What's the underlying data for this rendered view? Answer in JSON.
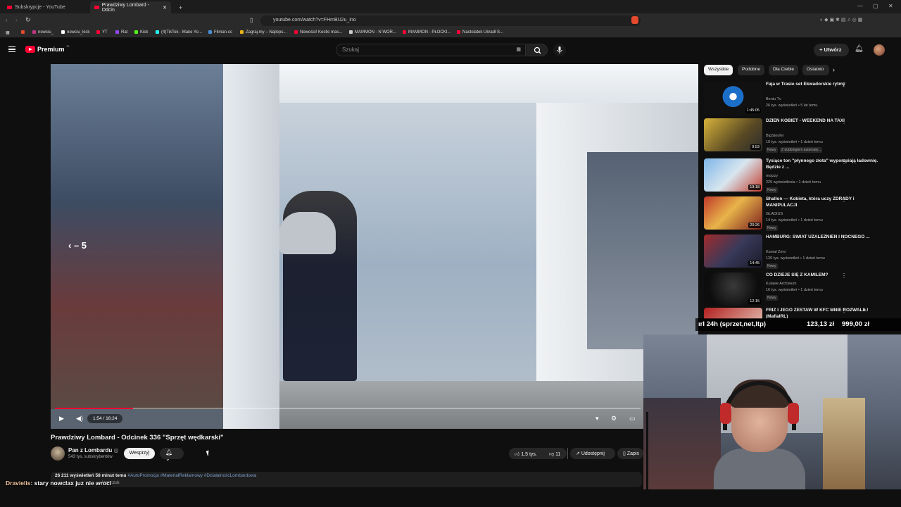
{
  "browser": {
    "tabs": [
      {
        "label": "Subskrypcje - YouTube"
      },
      {
        "label": "Prawdziwy Lombard - Odcin"
      }
    ],
    "url": "youtube.com/watch?v=FHmBU2u_ino",
    "bookmarks": [
      "nowciu_",
      "nowciu_kick",
      "YT",
      "Rat",
      "Kick",
      "(4)TikTok - Make Yo...",
      "Filman.cc",
      "Zagraj.my – Najleps...",
      "Nowości! Kostki mas...",
      "MAMMON - N WOR...",
      "MAMMON - PŁOCKI...",
      "Nastolatek Ukradł S..."
    ]
  },
  "header": {
    "logo_text": "Premium",
    "logo_sup": "PL",
    "search_placeholder": "Szukaj",
    "create_label": "+ Utwórz"
  },
  "player": {
    "seek_indicator": "‹ – 5",
    "time": "1:54 / 16:24",
    "progress": 0.133
  },
  "video": {
    "title": "Prawdziwy Lombard - Odcinek 336 \"Sprzęt wędkarski\"",
    "channel": "Pan z Lombardu",
    "subscribers": "543 tys. subskrybentów",
    "support_label": "Wesprzyj",
    "likes": "1,5 tys.",
    "dislikes": "11",
    "share_label": "Udostępnij",
    "save_label": "Zapis",
    "views_time": "26 211 wyświetleń  58 minut temu",
    "tags": "#AutoPromocja #MateriałReklamowy #DziałalnośćLombardowa",
    "desc_more": "...iwanczuk"
  },
  "chat": {
    "user": "Dravielis",
    "message": ": stary nowclax juz nie wroci"
  },
  "sidebar": {
    "chips": [
      "Wszystkie",
      "Podobne",
      "Dla Ciebie",
      "Ostatnio"
    ],
    "recommendations": [
      {
        "title": "Faja w Trasie set Ekwadorskie rytmy",
        "channel": "Beniu Tv",
        "meta": "26 tys. wyświetleń • 5 lat temu",
        "duration": "1:45:05",
        "badge": "",
        "badge2": "",
        "color": "#1c6fc9"
      },
      {
        "title": "DZIEŃ KOBIET - WEEKEND NA TAXI",
        "channel": "BigStoofer",
        "meta": "10 tys. wyświetleń • 1 dzień temu",
        "duration": "9:53",
        "badge": "Nowy",
        "badge2": "Z dubbingiem automaty...",
        "color": "#8a6a2a"
      },
      {
        "title": "Tysiące ton \"płynnego złota\" wypompiają ładownię. Będzie z ...",
        "channel": "mojzzy",
        "meta": "225 wyświetlenia • 1 dzień temu",
        "duration": "19:18",
        "badge": "Nowy",
        "badge2": "",
        "color": "#3a8ad6"
      },
      {
        "title": "Shallon — Kobieta, która uczy ZDRADY i MANIPULACJI",
        "channel": "GLADIUS",
        "meta": "14 tys. wyświetleń • 1 dzień temu",
        "duration": "20:26",
        "badge": "Nowy",
        "badge2": "",
        "color": "#c0392b"
      },
      {
        "title": "HAMBURG: ŚWIAT UZALEŻNIEŃ I NOCNEGO ...",
        "channel": "Kamal Zero",
        "meta": "120 tys. wyświetleń • 1 dzień temu",
        "duration": "14:45",
        "badge": "Nowy",
        "badge2": "",
        "color": "#a02b2b"
      },
      {
        "title": "CO DZIEJE SIĘ Z KAMILEM?",
        "channel": "Kulawe Archiwum",
        "meta": "16 tys. wyświetleń • 1 dzień temu",
        "duration": "12:15",
        "badge": "Nowy",
        "badge2": "",
        "color": "#1a1a1a"
      },
      {
        "title": "FRIZ I JEGO ZESTAW W KFC MNIE ROZWALIŁ! (MafiaIRL)",
        "channel": "",
        "meta": "",
        "duration": "",
        "badge": "",
        "badge2": "",
        "color": "#b32020"
      }
    ]
  },
  "overlay": {
    "label": "ırl 24h (sprzet,net,ltp)",
    "current": "123,13 zł",
    "goal": "999,00 zł"
  },
  "colors": {
    "accent": "#ff0033",
    "bg": "#0f0f0f",
    "chip_bg": "#272727"
  }
}
